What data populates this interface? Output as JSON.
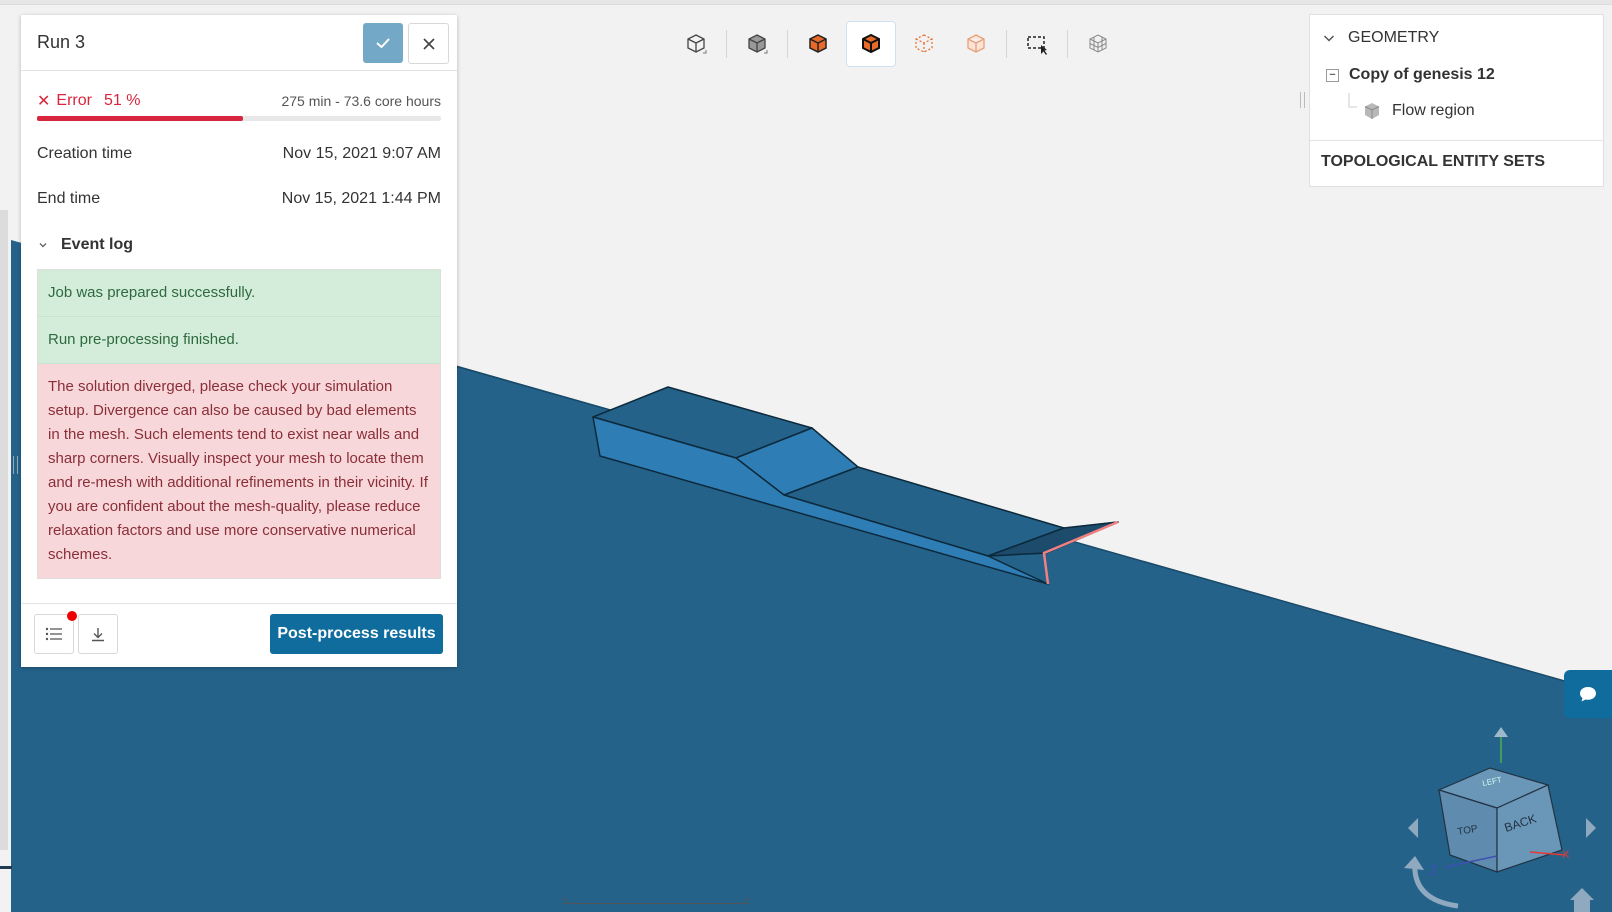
{
  "run_panel": {
    "title": "Run 3",
    "status": {
      "label": "Error",
      "percent_text": "51 %",
      "progress": 0.51,
      "duration": "275 min - 73.6 core hours"
    },
    "creation_time": {
      "label": "Creation time",
      "value": "Nov 15, 2021 9:07 AM"
    },
    "end_time": {
      "label": "End time",
      "value": "Nov 15, 2021 1:44 PM"
    },
    "event_log": {
      "label": "Event log",
      "entries": [
        {
          "type": "success",
          "text": "Job was prepared successfully."
        },
        {
          "type": "success",
          "text": "Run pre-processing finished."
        },
        {
          "type": "error",
          "text": "The solution diverged, please check your simulation setup. Divergence can also be caused by bad elements in the mesh. Such elements tend to exist near walls and sharp corners. Visually inspect your mesh to locate them and re-mesh with additional refinements in their vicinity. If you are confident about the mesh-quality, please reduce relaxation factors and use more conservative numerical schemes."
        }
      ]
    },
    "footer": {
      "post_process_label": "Post-process results"
    }
  },
  "geometry_panel": {
    "heading": "GEOMETRY",
    "root": "Copy of genesis 12",
    "child": "Flow region",
    "topological_sets": "TOPOLOGICAL ENTITY SETS"
  },
  "toolbar": {
    "icons": [
      "solid-box-icon",
      "shaded-box-icon",
      "orange-solid-box-icon",
      "orange-wireframe-box-icon",
      "points-box-icon",
      "transparent-box-icon",
      "box-select-icon",
      "grid-box-icon"
    ]
  },
  "view_cube": {
    "faces": [
      "LEFT",
      "TOP",
      "BACK"
    ],
    "axes": [
      "Y",
      "Z",
      "X"
    ]
  },
  "colors": {
    "accent": "#0f6c9d",
    "error": "#d7263d",
    "viewport_bg": "#f2f2f2",
    "floor": "#24628a",
    "model": "#2f7db5",
    "highlight_edge": "#f28080"
  }
}
